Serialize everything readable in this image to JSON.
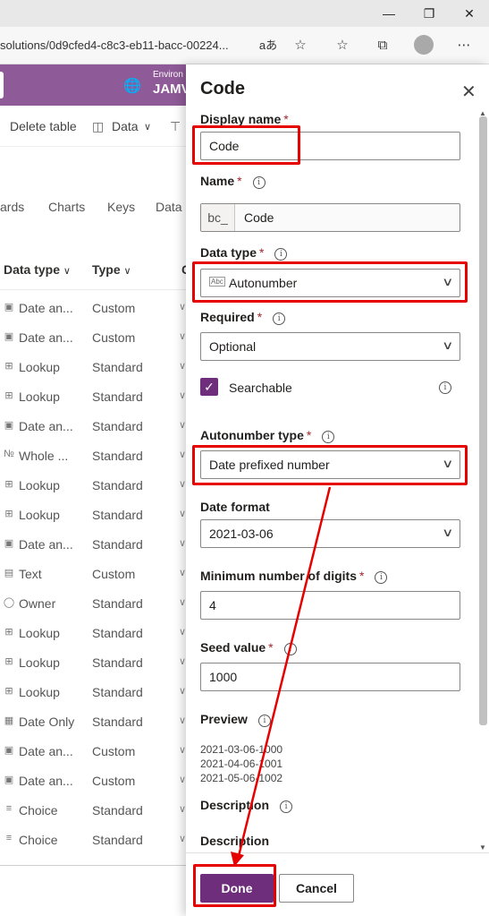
{
  "browser": {
    "url": "solutions/0d9cfed4-c8c3-eb11-bacc-00224...",
    "read_aloud_glyph": "aあ",
    "icons": [
      "read-aloud-icon",
      "add-favorite-icon",
      "favorites-icon",
      "collections-icon",
      "profile-avatar",
      "more-icon"
    ],
    "window_controls": [
      "minimize-icon",
      "restore-icon",
      "close-icon"
    ]
  },
  "app": {
    "env_label": "Environ",
    "env_name": "JAMV",
    "commands": {
      "delete_table": "Delete table",
      "data": "Data"
    },
    "tabs": [
      "ards",
      "Charts",
      "Keys",
      "Data"
    ],
    "columns": {
      "data_type": "Data type",
      "type": "Type",
      "next": "C"
    },
    "rows": [
      {
        "icon": "date-icon",
        "data_type": "Date an...",
        "type": "Custom"
      },
      {
        "icon": "date-icon",
        "data_type": "Date an...",
        "type": "Custom"
      },
      {
        "icon": "lookup-icon",
        "data_type": "Lookup",
        "type": "Standard"
      },
      {
        "icon": "lookup-icon",
        "data_type": "Lookup",
        "type": "Standard"
      },
      {
        "icon": "date-icon",
        "data_type": "Date an...",
        "type": "Standard"
      },
      {
        "icon": "number-icon",
        "data_type": "Whole ...",
        "type": "Standard"
      },
      {
        "icon": "lookup-icon",
        "data_type": "Lookup",
        "type": "Standard"
      },
      {
        "icon": "lookup-icon",
        "data_type": "Lookup",
        "type": "Standard"
      },
      {
        "icon": "date-icon",
        "data_type": "Date an...",
        "type": "Standard"
      },
      {
        "icon": "text-icon",
        "data_type": "Text",
        "type": "Custom"
      },
      {
        "icon": "owner-icon",
        "data_type": "Owner",
        "type": "Standard"
      },
      {
        "icon": "lookup-icon",
        "data_type": "Lookup",
        "type": "Standard"
      },
      {
        "icon": "lookup-icon",
        "data_type": "Lookup",
        "type": "Standard"
      },
      {
        "icon": "lookup-icon",
        "data_type": "Lookup",
        "type": "Standard"
      },
      {
        "icon": "dateonly-icon",
        "data_type": "Date Only",
        "type": "Standard"
      },
      {
        "icon": "date-icon",
        "data_type": "Date an...",
        "type": "Custom"
      },
      {
        "icon": "date-icon",
        "data_type": "Date an...",
        "type": "Custom"
      },
      {
        "icon": "choice-icon",
        "data_type": "Choice",
        "type": "Standard"
      },
      {
        "icon": "choice-icon",
        "data_type": "Choice",
        "type": "Standard"
      }
    ]
  },
  "panel": {
    "title": "Code",
    "display_name": {
      "label": "Display name",
      "value": "Code"
    },
    "name": {
      "label": "Name",
      "prefix": "bc_",
      "value": "Code"
    },
    "data_type": {
      "label": "Data type",
      "value": "Autonumber"
    },
    "required": {
      "label": "Required",
      "value": "Optional"
    },
    "searchable": {
      "label": "Searchable",
      "checked": true
    },
    "autonumber_type": {
      "label": "Autonumber type",
      "value": "Date prefixed number"
    },
    "date_format": {
      "label": "Date format",
      "value": "2021-03-06"
    },
    "min_digits": {
      "label": "Minimum number of digits",
      "value": "4"
    },
    "seed_value": {
      "label": "Seed value",
      "value": "1000"
    },
    "preview": {
      "label": "Preview",
      "lines": [
        "2021-03-06-1000",
        "2021-04-06-1001",
        "2021-05-06-1002"
      ]
    },
    "description_heading": "Description",
    "description_label": "Description",
    "buttons": {
      "done": "Done",
      "cancel": "Cancel"
    }
  },
  "colors": {
    "accent": "#6f2e7c",
    "header": "#8e5a97",
    "annotation": "#e60000"
  }
}
